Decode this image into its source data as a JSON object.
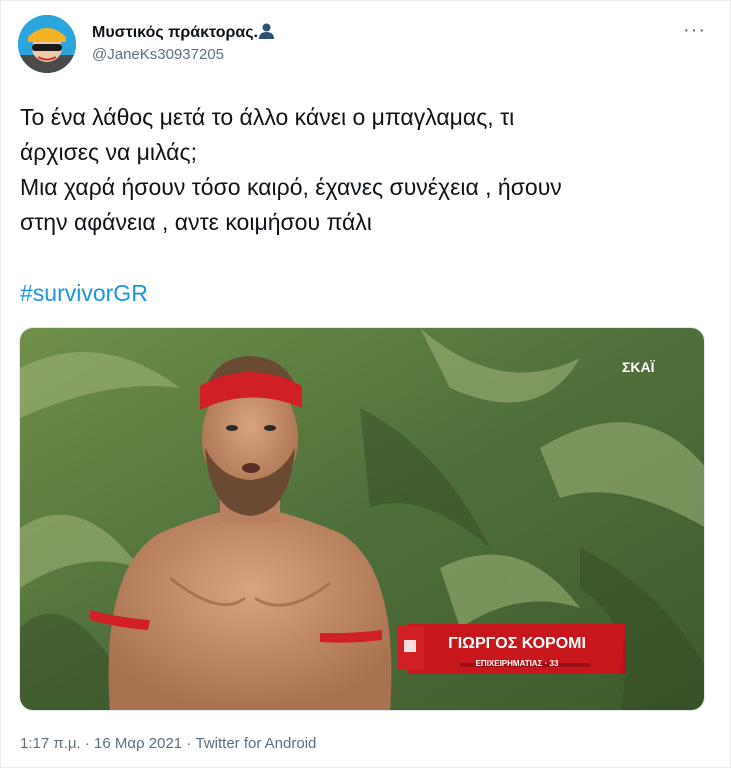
{
  "author": {
    "display_name": "Μυστικός πράκτορας.",
    "emoji_icon": "bust-silhouette-icon",
    "handle": "@JaneKs30937205",
    "avatar_icon": "avatar-icon"
  },
  "menu": {
    "more_icon": "more-options-icon",
    "glyph": "···"
  },
  "tweet": {
    "lines": [
      "Το ένα λάθος μετά το άλλο κάνει ο μπαγλαμας,  τι",
      "άρχισες να μιλάς;",
      "Μια χαρά ήσουν τόσο καιρό, έχανες συνέχεια , ήσουν",
      "στην αφάνεια , αντε κοιμήσου πάλι"
    ],
    "hashtag": "#survivorGR"
  },
  "media": {
    "channel_logo": "ΣΚΑΪ",
    "caption_name": "ΓΙΩΡΓΟΣ ΚΟΡΟΜΙ",
    "caption_sub": "ΕΠΙΧΕΙΡΗΜΑΤΙΑΣ · 33"
  },
  "footer": {
    "time": "1:17 π.μ.",
    "sep1": " · ",
    "date": "16 Μαρ 2021",
    "sep2": " · ",
    "source": "Twitter for Android"
  },
  "colors": {
    "text": "#0f1419",
    "secondary": "#5b7083",
    "link": "#1b95e0",
    "caption_red": "#c8161d"
  }
}
